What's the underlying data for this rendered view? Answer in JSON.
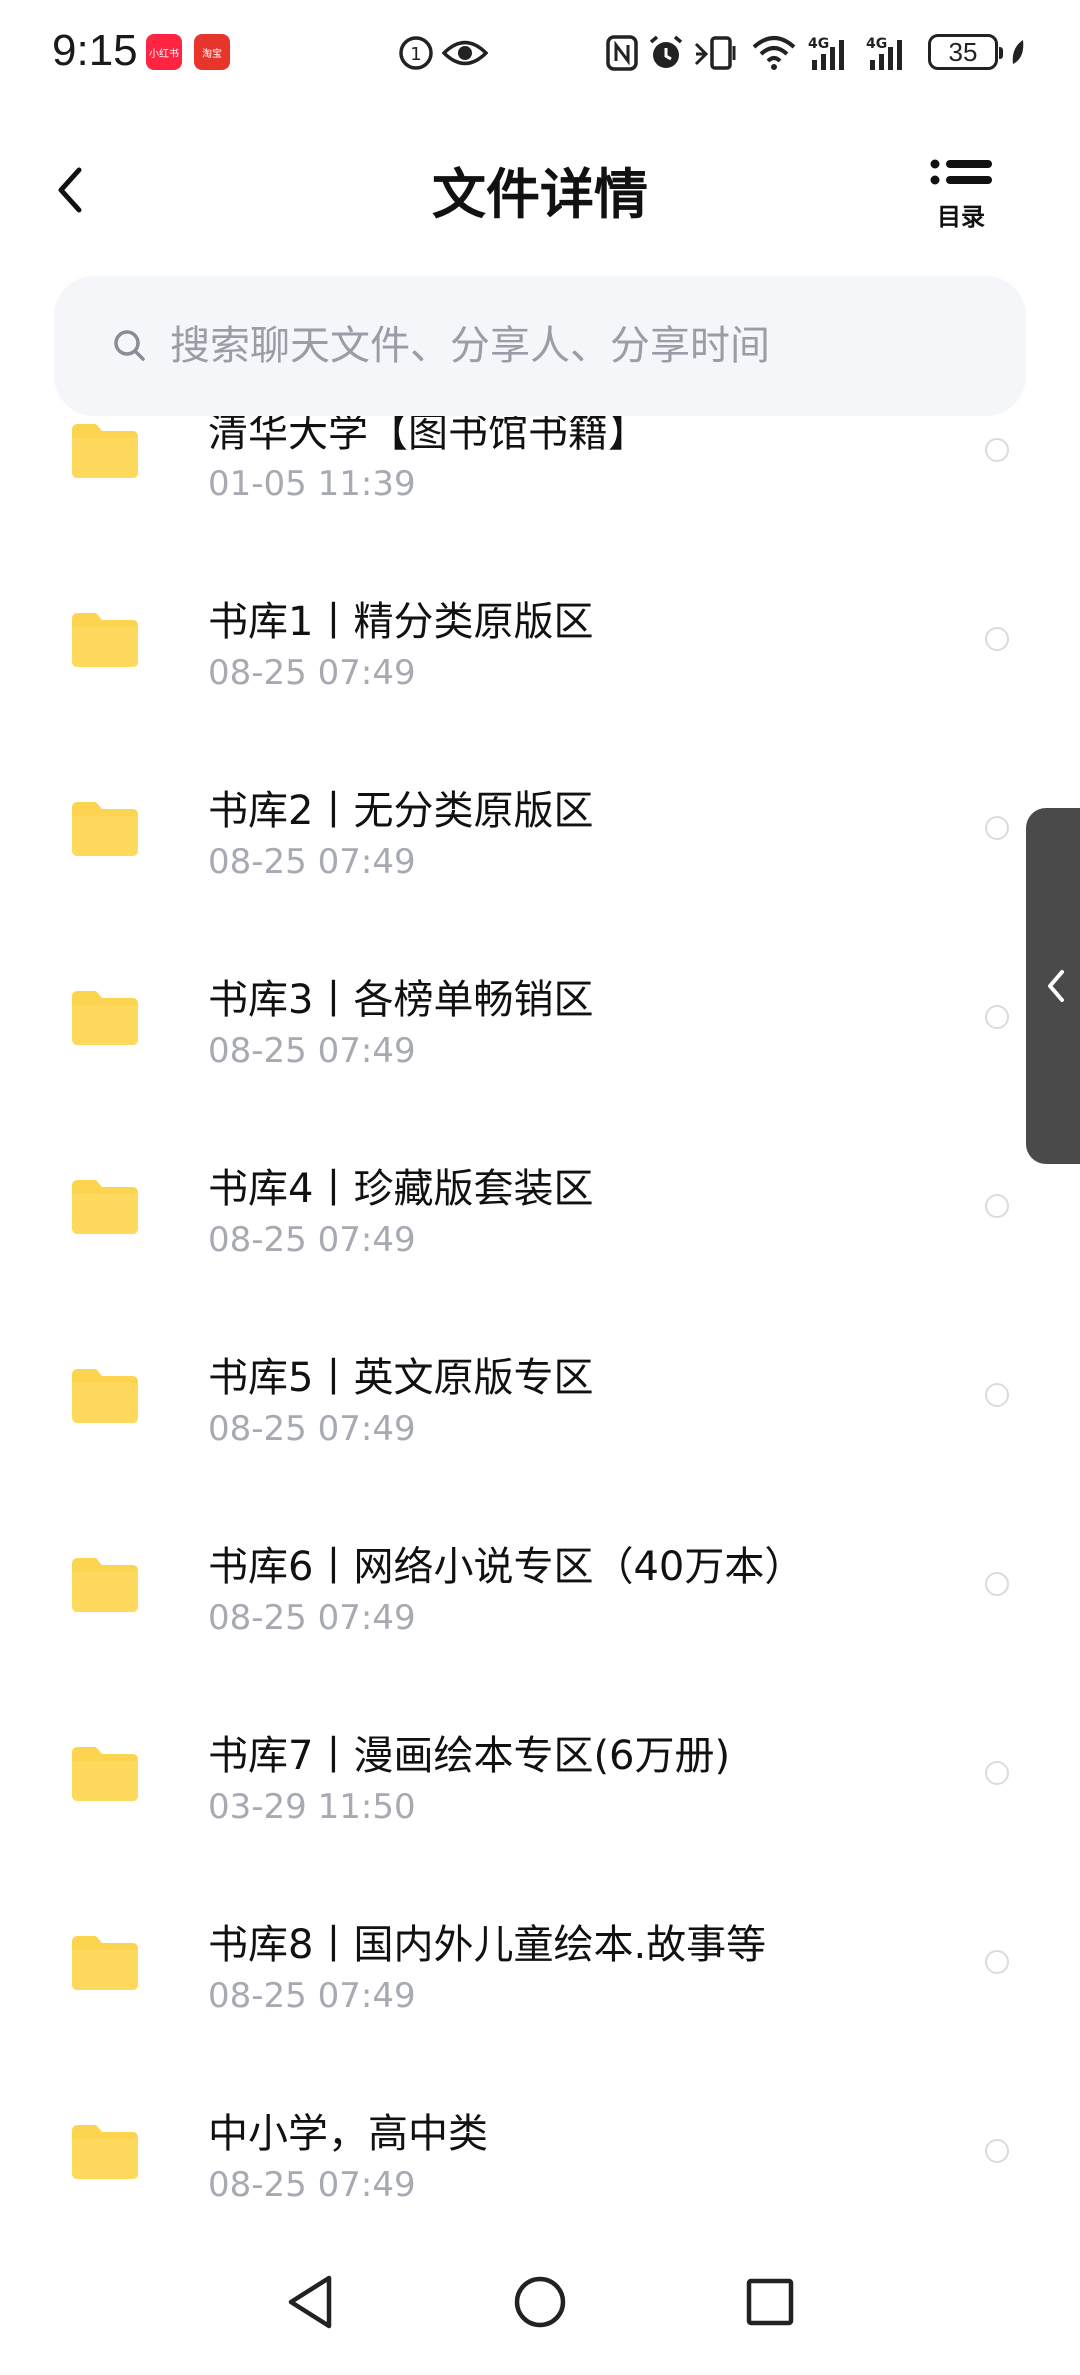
{
  "status_bar": {
    "time": "9:15",
    "battery_level": "35",
    "icons": [
      "xiaohongshu-app-icon",
      "food-app-icon",
      "data-saver-icon",
      "eye-icon",
      "nfc-icon",
      "alarm-icon",
      "vibrate-icon",
      "wifi-icon",
      "4g-signal-icon",
      "4g-signal-icon",
      "battery-icon",
      "leaf-icon"
    ],
    "app_labels": [
      "小红书",
      "淘宝"
    ]
  },
  "header": {
    "title": "文件详情",
    "toc_label": "目录"
  },
  "search": {
    "placeholder": "搜索聊天文件、分享人、分享时间"
  },
  "files": [
    {
      "name": "清华大学【图书馆书籍】",
      "date": "01-05  11:39"
    },
    {
      "name": "书库1丨精分类原版区",
      "date": "08-25  07:49"
    },
    {
      "name": "书库2丨无分类原版区",
      "date": "08-25  07:49"
    },
    {
      "name": "书库3丨各榜单畅销区",
      "date": "08-25  07:49"
    },
    {
      "name": "书库4丨珍藏版套装区",
      "date": "08-25  07:49"
    },
    {
      "name": "书库5丨英文原版专区",
      "date": "08-25  07:49"
    },
    {
      "name": "书库6丨网络小说专区（40万本）",
      "date": "08-25  07:49"
    },
    {
      "name": "书库7丨漫画绘本专区(6万册)",
      "date": "03-29  11:50"
    },
    {
      "name": "书库8丨国内外儿童绘本.故事等",
      "date": "08-25  07:49"
    },
    {
      "name": "中小学，高中类",
      "date": "08-25  07:49"
    }
  ],
  "colors": {
    "folder": "#fdd44f",
    "date_text": "#a7a9b3",
    "search_bg": "#f5f6fa",
    "side_handle": "#4a4a4a"
  }
}
